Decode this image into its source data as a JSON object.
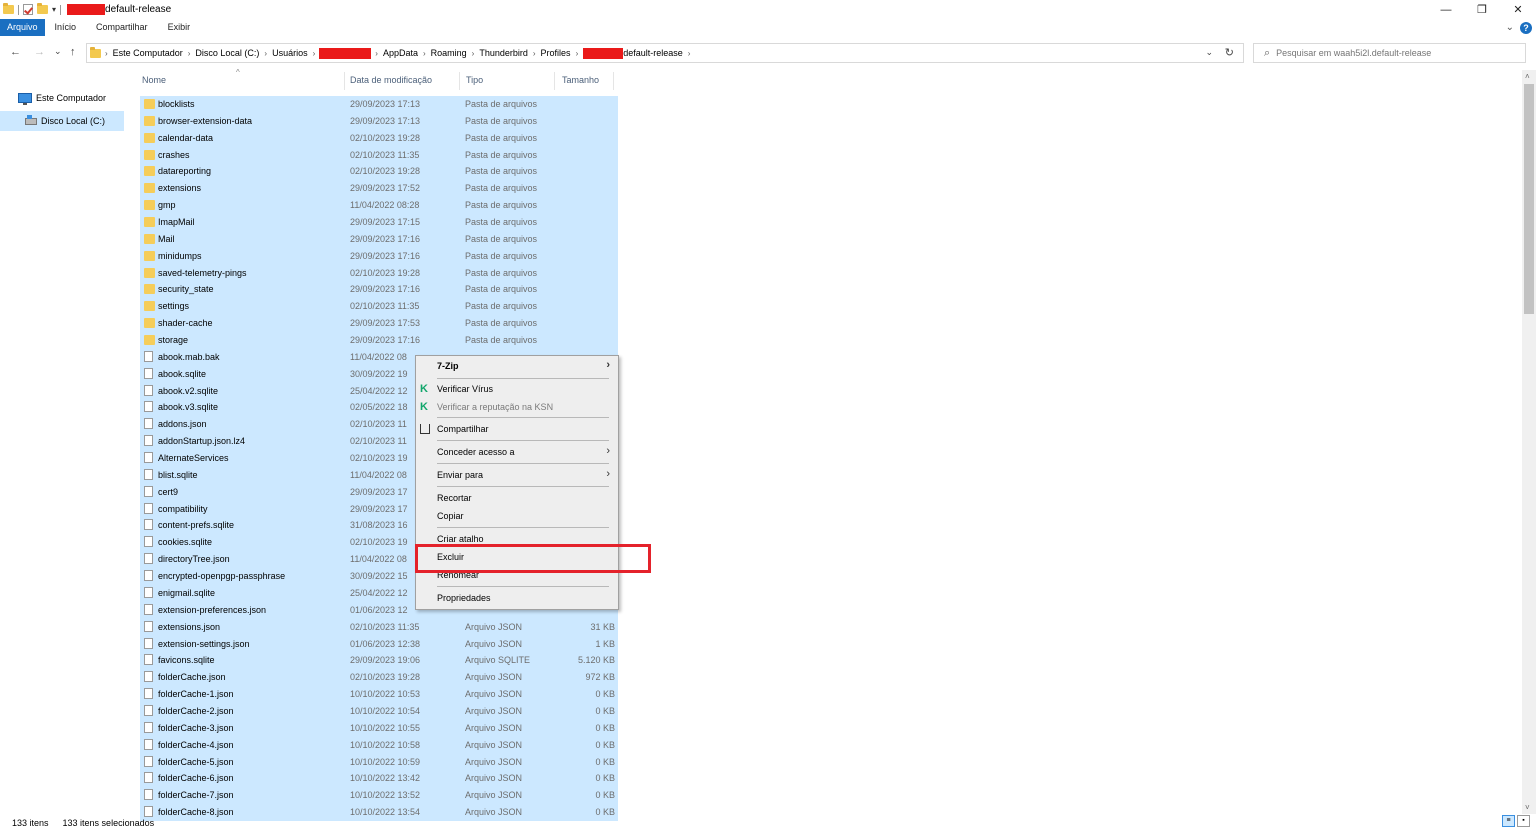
{
  "window": {
    "title_suffix": "default-release",
    "minimize": "—",
    "restore": "❐",
    "close": "✕"
  },
  "ribbon": {
    "tabs": [
      "Arquivo",
      "Início",
      "Compartilhar",
      "Exibir"
    ],
    "expand_chevron": "⌄",
    "help": "?"
  },
  "nav": {
    "back": "←",
    "forward": "→",
    "recent": "⌄",
    "up": "↑"
  },
  "address": {
    "crumbs": [
      "Este Computador",
      "Disco Local (C:)",
      "Usuários",
      "AppData",
      "Roaming",
      "Thunderbird",
      "Profiles"
    ],
    "last_suffix": "default-release",
    "separator": "›",
    "dropdown": "⌄",
    "refresh": "↻"
  },
  "search": {
    "placeholder": "Pesquisar em waah5i2l.default-release",
    "icon": "⌕"
  },
  "navpane": {
    "items": [
      {
        "label": "Este Computador",
        "icon": "computer-icon"
      },
      {
        "label": "Disco Local (C:)",
        "icon": "disk-icon"
      }
    ]
  },
  "columns": {
    "name": "Nome",
    "date": "Data de modificação",
    "type": "Tipo",
    "size": "Tamanho",
    "sort_arrow": "^"
  },
  "files": [
    {
      "name": "blocklists",
      "date": "29/09/2023 17:13",
      "type": "Pasta de arquivos",
      "size": "",
      "kind": "folder"
    },
    {
      "name": "browser-extension-data",
      "date": "29/09/2023 17:13",
      "type": "Pasta de arquivos",
      "size": "",
      "kind": "folder"
    },
    {
      "name": "calendar-data",
      "date": "02/10/2023 19:28",
      "type": "Pasta de arquivos",
      "size": "",
      "kind": "folder"
    },
    {
      "name": "crashes",
      "date": "02/10/2023 11:35",
      "type": "Pasta de arquivos",
      "size": "",
      "kind": "folder"
    },
    {
      "name": "datareporting",
      "date": "02/10/2023 19:28",
      "type": "Pasta de arquivos",
      "size": "",
      "kind": "folder"
    },
    {
      "name": "extensions",
      "date": "29/09/2023 17:52",
      "type": "Pasta de arquivos",
      "size": "",
      "kind": "folder"
    },
    {
      "name": "gmp",
      "date": "11/04/2022 08:28",
      "type": "Pasta de arquivos",
      "size": "",
      "kind": "folder"
    },
    {
      "name": "ImapMail",
      "date": "29/09/2023 17:15",
      "type": "Pasta de arquivos",
      "size": "",
      "kind": "folder"
    },
    {
      "name": "Mail",
      "date": "29/09/2023 17:16",
      "type": "Pasta de arquivos",
      "size": "",
      "kind": "folder"
    },
    {
      "name": "minidumps",
      "date": "29/09/2023 17:16",
      "type": "Pasta de arquivos",
      "size": "",
      "kind": "folder"
    },
    {
      "name": "saved-telemetry-pings",
      "date": "02/10/2023 19:28",
      "type": "Pasta de arquivos",
      "size": "",
      "kind": "folder"
    },
    {
      "name": "security_state",
      "date": "29/09/2023 17:16",
      "type": "Pasta de arquivos",
      "size": "",
      "kind": "folder"
    },
    {
      "name": "settings",
      "date": "02/10/2023 11:35",
      "type": "Pasta de arquivos",
      "size": "",
      "kind": "folder"
    },
    {
      "name": "shader-cache",
      "date": "29/09/2023 17:53",
      "type": "Pasta de arquivos",
      "size": "",
      "kind": "folder"
    },
    {
      "name": "storage",
      "date": "29/09/2023 17:16",
      "type": "Pasta de arquivos",
      "size": "",
      "kind": "folder"
    },
    {
      "name": "abook.mab.bak",
      "date": "11/04/2022 08",
      "type": "",
      "size": "",
      "kind": "file"
    },
    {
      "name": "abook.sqlite",
      "date": "30/09/2022 19",
      "type": "",
      "size": "",
      "kind": "file"
    },
    {
      "name": "abook.v2.sqlite",
      "date": "25/04/2022 12",
      "type": "",
      "size": "",
      "kind": "file"
    },
    {
      "name": "abook.v3.sqlite",
      "date": "02/05/2022 18",
      "type": "",
      "size": "",
      "kind": "file"
    },
    {
      "name": "addons.json",
      "date": "02/10/2023 11",
      "type": "",
      "size": "",
      "kind": "file"
    },
    {
      "name": "addonStartup.json.lz4",
      "date": "02/10/2023 11",
      "type": "",
      "size": "",
      "kind": "file"
    },
    {
      "name": "AlternateServices",
      "date": "02/10/2023 19",
      "type": "",
      "size": "",
      "kind": "file"
    },
    {
      "name": "blist.sqlite",
      "date": "11/04/2022 08",
      "type": "",
      "size": "",
      "kind": "file"
    },
    {
      "name": "cert9",
      "date": "29/09/2023 17",
      "type": "",
      "size": "",
      "kind": "file"
    },
    {
      "name": "compatibility",
      "date": "29/09/2023 17",
      "type": "",
      "size": "",
      "kind": "file"
    },
    {
      "name": "content-prefs.sqlite",
      "date": "31/08/2023 16",
      "type": "",
      "size": "",
      "kind": "file"
    },
    {
      "name": "cookies.sqlite",
      "date": "02/10/2023 19",
      "type": "",
      "size": "",
      "kind": "file"
    },
    {
      "name": "directoryTree.json",
      "date": "11/04/2022 08",
      "type": "",
      "size": "",
      "kind": "file"
    },
    {
      "name": "encrypted-openpgp-passphrase",
      "date": "30/09/2022 15",
      "type": "",
      "size": "",
      "kind": "file"
    },
    {
      "name": "enigmail.sqlite",
      "date": "25/04/2022 12",
      "type": "",
      "size": "",
      "kind": "file"
    },
    {
      "name": "extension-preferences.json",
      "date": "01/06/2023 12",
      "type": "",
      "size": "",
      "kind": "file"
    },
    {
      "name": "extensions.json",
      "date": "02/10/2023 11:35",
      "type": "Arquivo JSON",
      "size": "31 KB",
      "kind": "file"
    },
    {
      "name": "extension-settings.json",
      "date": "01/06/2023 12:38",
      "type": "Arquivo JSON",
      "size": "1 KB",
      "kind": "file"
    },
    {
      "name": "favicons.sqlite",
      "date": "29/09/2023 19:06",
      "type": "Arquivo SQLITE",
      "size": "5.120 KB",
      "kind": "file"
    },
    {
      "name": "folderCache.json",
      "date": "02/10/2023 19:28",
      "type": "Arquivo JSON",
      "size": "972 KB",
      "kind": "file"
    },
    {
      "name": "folderCache-1.json",
      "date": "10/10/2022 10:53",
      "type": "Arquivo JSON",
      "size": "0 KB",
      "kind": "file"
    },
    {
      "name": "folderCache-2.json",
      "date": "10/10/2022 10:54",
      "type": "Arquivo JSON",
      "size": "0 KB",
      "kind": "file"
    },
    {
      "name": "folderCache-3.json",
      "date": "10/10/2022 10:55",
      "type": "Arquivo JSON",
      "size": "0 KB",
      "kind": "file"
    },
    {
      "name": "folderCache-4.json",
      "date": "10/10/2022 10:58",
      "type": "Arquivo JSON",
      "size": "0 KB",
      "kind": "file"
    },
    {
      "name": "folderCache-5.json",
      "date": "10/10/2022 10:59",
      "type": "Arquivo JSON",
      "size": "0 KB",
      "kind": "file"
    },
    {
      "name": "folderCache-6.json",
      "date": "10/10/2022 13:42",
      "type": "Arquivo JSON",
      "size": "0 KB",
      "kind": "file"
    },
    {
      "name": "folderCache-7.json",
      "date": "10/10/2022 13:52",
      "type": "Arquivo JSON",
      "size": "0 KB",
      "kind": "file"
    },
    {
      "name": "folderCache-8.json",
      "date": "10/10/2022 13:54",
      "type": "Arquivo JSON",
      "size": "0 KB",
      "kind": "file"
    }
  ],
  "context_menu": {
    "sevenzip": "7-Zip",
    "scan": "Verificar Vírus",
    "ksn": "Verificar a reputação na KSN",
    "share": "Compartilhar",
    "grant_access": "Conceder acesso a",
    "send_to": "Enviar para",
    "cut": "Recortar",
    "copy": "Copiar",
    "shortcut": "Criar atalho",
    "delete": "Excluir",
    "rename": "Renomear",
    "properties": "Propriedades",
    "submenu_arrow": "›",
    "kaspersky_glyph": "K"
  },
  "status": {
    "count": "133 itens",
    "selected": "133 itens selecionados"
  },
  "colors": {
    "selection": "#cce8ff",
    "accent": "#1a6fc1",
    "highlight": "#e4222b",
    "folder": "#f5cd5a"
  }
}
